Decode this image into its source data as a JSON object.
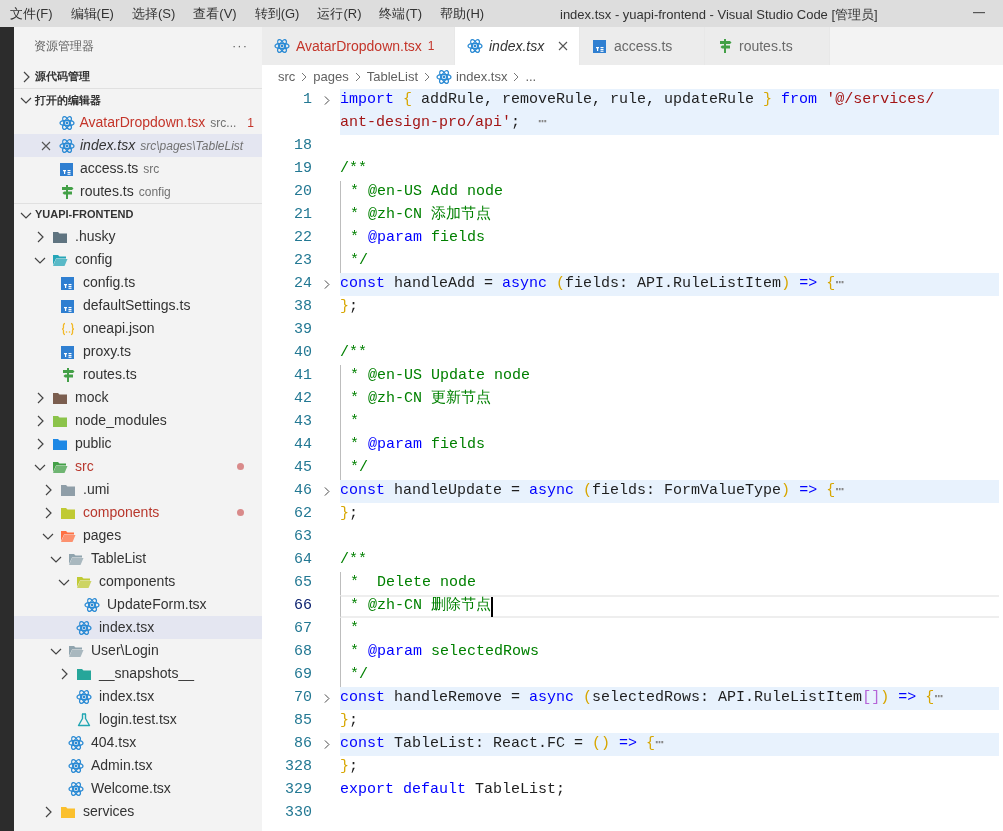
{
  "menu": [
    "文件(F)",
    "编辑(E)",
    "选择(S)",
    "查看(V)",
    "转到(G)",
    "运行(R)",
    "终端(T)",
    "帮助(H)"
  ],
  "window": {
    "title": "index.tsx - yuapi-frontend - Visual Studio Code [管理员]"
  },
  "sidebar": {
    "title": "资源管理器",
    "more": "···",
    "sections": [
      {
        "label": "源代码管理",
        "expanded": false
      },
      {
        "label": "打开的编辑器",
        "expanded": true
      }
    ],
    "open_editors": [
      {
        "name": "AvatarDropdown.tsx",
        "description": "src...",
        "problems": "1",
        "kind": "react",
        "error": true,
        "preview": false,
        "selected": false
      },
      {
        "name": "index.tsx",
        "description": "src\\pages\\TableList",
        "kind": "react",
        "error": false,
        "preview": true,
        "selected": true
      },
      {
        "name": "access.ts",
        "description": "src",
        "kind": "ts",
        "error": false,
        "preview": false,
        "selected": false
      },
      {
        "name": "routes.ts",
        "description": "config",
        "kind": "routes",
        "error": false,
        "preview": false,
        "selected": false
      }
    ],
    "project": {
      "label": "YUAPI-FRONTEND",
      "expanded": true
    },
    "tree": [
      {
        "name": ".husky",
        "kind": "folder",
        "color": "#5f7480",
        "expanded": false,
        "selected": false
      },
      {
        "name": "config",
        "kind": "folder",
        "color": "#26a6b8",
        "expanded": true,
        "selected": false,
        "children": [
          {
            "name": "config.ts",
            "kind": "ts",
            "selected": false
          },
          {
            "name": "defaultSettings.ts",
            "kind": "ts",
            "selected": false
          },
          {
            "name": "oneapi.json",
            "kind": "json",
            "selected": false
          },
          {
            "name": "proxy.ts",
            "kind": "ts",
            "selected": false
          },
          {
            "name": "routes.ts",
            "kind": "routes",
            "selected": false
          }
        ]
      },
      {
        "name": "mock",
        "kind": "folder",
        "color": "#7b5e4f",
        "expanded": false,
        "selected": false
      },
      {
        "name": "node_modules",
        "kind": "folder",
        "color": "#8bc34a",
        "expanded": false,
        "selected": false
      },
      {
        "name": "public",
        "kind": "folder",
        "color": "#1e88e5",
        "expanded": false,
        "selected": false
      },
      {
        "name": "src",
        "kind": "folder",
        "color": "#43a047",
        "expanded": true,
        "modified": true,
        "selected": false,
        "children": [
          {
            "name": ".umi",
            "kind": "folder",
            "color": "#8f9ea8",
            "expanded": false,
            "selected": false
          },
          {
            "name": "components",
            "kind": "folder",
            "color": "#c0ca33",
            "expanded": false,
            "modified": true,
            "selected": false
          },
          {
            "name": "pages",
            "kind": "folder",
            "color": "#ff7043",
            "expanded": true,
            "selected": false,
            "children": [
              {
                "name": "TableList",
                "kind": "folder",
                "color": "#90a4ae",
                "expanded": true,
                "selected": false,
                "children": [
                  {
                    "name": "components",
                    "kind": "folder",
                    "color": "#c0ca33",
                    "expanded": true,
                    "selected": false,
                    "children": [
                      {
                        "name": "UpdateForm.tsx",
                        "kind": "react",
                        "selected": false
                      }
                    ]
                  },
                  {
                    "name": "index.tsx",
                    "kind": "react",
                    "selected": true
                  }
                ]
              },
              {
                "name": "User\\Login",
                "kind": "folder",
                "color": "#90a4ae",
                "expanded": true,
                "selected": false,
                "children": [
                  {
                    "name": "__snapshots__",
                    "kind": "folder",
                    "color": "#26a69a",
                    "expanded": false,
                    "selected": false
                  },
                  {
                    "name": "index.tsx",
                    "kind": "react",
                    "selected": false
                  },
                  {
                    "name": "login.test.tsx",
                    "kind": "test",
                    "selected": false
                  }
                ]
              },
              {
                "name": "404.tsx",
                "kind": "react",
                "selected": false
              },
              {
                "name": "Admin.tsx",
                "kind": "react",
                "selected": false
              },
              {
                "name": "Welcome.tsx",
                "kind": "react",
                "selected": false
              }
            ]
          },
          {
            "name": "services",
            "kind": "folder",
            "color": "#fbc02d",
            "expanded": false,
            "selected": false
          }
        ]
      }
    ]
  },
  "tabs": [
    {
      "label": "AvatarDropdown.tsx",
      "problems": "1",
      "kind": "react",
      "error": true,
      "preview": false,
      "selected": false
    },
    {
      "label": "index.tsx",
      "kind": "react",
      "error": false,
      "preview": true,
      "selected": true
    },
    {
      "label": "access.ts",
      "kind": "ts",
      "error": false,
      "preview": false,
      "selected": false
    },
    {
      "label": "routes.ts",
      "kind": "routes",
      "error": false,
      "preview": false,
      "selected": false
    }
  ],
  "breadcrumb": [
    {
      "label": "src",
      "kind": "folder"
    },
    {
      "label": "pages",
      "kind": "folder"
    },
    {
      "label": "TableList",
      "kind": "folder"
    },
    {
      "label": "index.tsx",
      "kind": "react"
    },
    {
      "label": "...",
      "kind": "symbol"
    }
  ],
  "code": [
    {
      "number": "1",
      "folded": true,
      "tokens": [
        {
          "kind": "kw",
          "text": "import"
        },
        {
          "kind": "brace",
          "text": " {"
        },
        {
          "kind": "id",
          "text": " addRule, removeRule, rule, updateRule "
        },
        {
          "kind": "brace",
          "text": "}"
        },
        {
          "kind": "kw",
          "text": " from"
        },
        {
          "kind": "str",
          "text": " '@/services/"
        }
      ],
      "wrapped_tokens": [
        {
          "kind": "str",
          "text": "ant-design-pro/api'"
        },
        {
          "kind": "id",
          "text": ";  "
        },
        {
          "kind": "fold",
          "text": "⋯"
        }
      ]
    },
    {
      "number": "18"
    },
    {
      "number": "19",
      "tokens": [
        {
          "kind": "comment",
          "text": "/**"
        }
      ]
    },
    {
      "number": "20",
      "guide": true,
      "tokens": [
        {
          "kind": "comment",
          "text": " * @en-US Add node"
        }
      ]
    },
    {
      "number": "21",
      "guide": true,
      "tokens": [
        {
          "kind": "comment",
          "text": " * @zh-CN 添加节点"
        }
      ]
    },
    {
      "number": "22",
      "guide": true,
      "tokens": [
        {
          "kind": "comment",
          "text": " * "
        },
        {
          "kind": "doctag",
          "text": "@param"
        },
        {
          "kind": "comment",
          "text": " fields"
        }
      ]
    },
    {
      "number": "23",
      "guide": true,
      "tokens": [
        {
          "kind": "comment",
          "text": " */"
        }
      ]
    },
    {
      "number": "24",
      "folded": true,
      "tokens": [
        {
          "kind": "kw",
          "text": "const"
        },
        {
          "kind": "id",
          "text": " handleAdd = "
        },
        {
          "kind": "kw",
          "text": "async"
        },
        {
          "kind": "brace",
          "text": " ("
        },
        {
          "kind": "id",
          "text": "fields: API.RuleListItem"
        },
        {
          "kind": "brace",
          "text": ")"
        },
        {
          "kind": "kw",
          "text": " =>"
        },
        {
          "kind": "brace",
          "text": " {"
        },
        {
          "kind": "fold",
          "text": "⋯"
        }
      ]
    },
    {
      "number": "38",
      "tokens": [
        {
          "kind": "brace",
          "text": "}"
        },
        {
          "kind": "id",
          "text": ";"
        }
      ]
    },
    {
      "number": "39"
    },
    {
      "number": "40",
      "tokens": [
        {
          "kind": "comment",
          "text": "/**"
        }
      ]
    },
    {
      "number": "41",
      "guide": true,
      "tokens": [
        {
          "kind": "comment",
          "text": " * @en-US Update node"
        }
      ]
    },
    {
      "number": "42",
      "guide": true,
      "tokens": [
        {
          "kind": "comment",
          "text": " * @zh-CN 更新节点"
        }
      ]
    },
    {
      "number": "43",
      "guide": true,
      "tokens": [
        {
          "kind": "comment",
          "text": " *"
        }
      ]
    },
    {
      "number": "44",
      "guide": true,
      "tokens": [
        {
          "kind": "comment",
          "text": " * "
        },
        {
          "kind": "doctag",
          "text": "@param"
        },
        {
          "kind": "comment",
          "text": " fields"
        }
      ]
    },
    {
      "number": "45",
      "guide": true,
      "tokens": [
        {
          "kind": "comment",
          "text": " */"
        }
      ]
    },
    {
      "number": "46",
      "folded": true,
      "tokens": [
        {
          "kind": "kw",
          "text": "const"
        },
        {
          "kind": "id",
          "text": " handleUpdate = "
        },
        {
          "kind": "kw",
          "text": "async"
        },
        {
          "kind": "brace",
          "text": " ("
        },
        {
          "kind": "id",
          "text": "fields: FormValueType"
        },
        {
          "kind": "brace",
          "text": ")"
        },
        {
          "kind": "kw",
          "text": " =>"
        },
        {
          "kind": "brace",
          "text": " {"
        },
        {
          "kind": "fold",
          "text": "⋯"
        }
      ]
    },
    {
      "number": "62",
      "tokens": [
        {
          "kind": "brace",
          "text": "}"
        },
        {
          "kind": "id",
          "text": ";"
        }
      ]
    },
    {
      "number": "63"
    },
    {
      "number": "64",
      "tokens": [
        {
          "kind": "comment",
          "text": "/**"
        }
      ]
    },
    {
      "number": "65",
      "guide": true,
      "tokens": [
        {
          "kind": "comment",
          "text": " *  Delete node"
        }
      ]
    },
    {
      "number": "66",
      "guide": true,
      "current": true,
      "tokens": [
        {
          "kind": "comment",
          "text": " * @zh-CN 删除节点"
        }
      ]
    },
    {
      "number": "67",
      "guide": true,
      "tokens": [
        {
          "kind": "comment",
          "text": " *"
        }
      ]
    },
    {
      "number": "68",
      "guide": true,
      "tokens": [
        {
          "kind": "comment",
          "text": " * "
        },
        {
          "kind": "doctag",
          "text": "@param"
        },
        {
          "kind": "comment",
          "text": " selectedRows"
        }
      ]
    },
    {
      "number": "69",
      "guide": true,
      "tokens": [
        {
          "kind": "comment",
          "text": " */"
        }
      ]
    },
    {
      "number": "70",
      "folded": true,
      "tokens": [
        {
          "kind": "kw",
          "text": "const"
        },
        {
          "kind": "id",
          "text": " handleRemove = "
        },
        {
          "kind": "kw",
          "text": "async"
        },
        {
          "kind": "brace",
          "text": " ("
        },
        {
          "kind": "id",
          "text": "selectedRows: API.RuleListItem"
        },
        {
          "kind": "bracket",
          "text": "[]"
        },
        {
          "kind": "brace",
          "text": ")"
        },
        {
          "kind": "kw",
          "text": " =>"
        },
        {
          "kind": "brace",
          "text": " {"
        },
        {
          "kind": "fold",
          "text": "⋯"
        }
      ]
    },
    {
      "number": "85",
      "tokens": [
        {
          "kind": "brace",
          "text": "}"
        },
        {
          "kind": "id",
          "text": ";"
        }
      ]
    },
    {
      "number": "86",
      "folded": true,
      "tokens": [
        {
          "kind": "kw",
          "text": "const"
        },
        {
          "kind": "id",
          "text": " TableList: React.FC = "
        },
        {
          "kind": "brace",
          "text": "()"
        },
        {
          "kind": "kw",
          "text": " =>"
        },
        {
          "kind": "brace",
          "text": " {"
        },
        {
          "kind": "fold",
          "text": "⋯"
        }
      ]
    },
    {
      "number": "328",
      "tokens": [
        {
          "kind": "brace",
          "text": "}"
        },
        {
          "kind": "id",
          "text": ";"
        }
      ]
    },
    {
      "number": "329",
      "tokens": [
        {
          "kind": "kw",
          "text": "export"
        },
        {
          "kind": "kw",
          "text": " default"
        },
        {
          "kind": "id",
          "text": " TableList;"
        }
      ]
    },
    {
      "number": "330"
    }
  ]
}
